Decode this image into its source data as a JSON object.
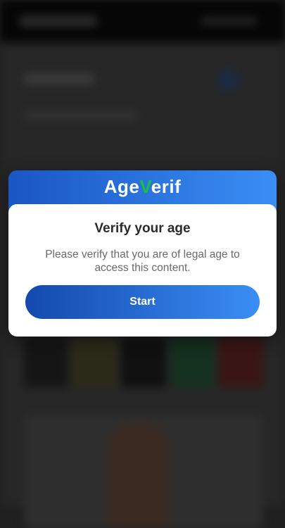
{
  "modal": {
    "brand_prefix": "Age",
    "brand_check": "V",
    "brand_suffix": "erif",
    "title": "Verify your age",
    "description": "Please verify that you are of legal age to access this content.",
    "start_label": "Start"
  },
  "colors": {
    "header_gradient_start": "#1a56c4",
    "header_gradient_end": "#3a8ef5",
    "check_accent": "#18c04a"
  }
}
